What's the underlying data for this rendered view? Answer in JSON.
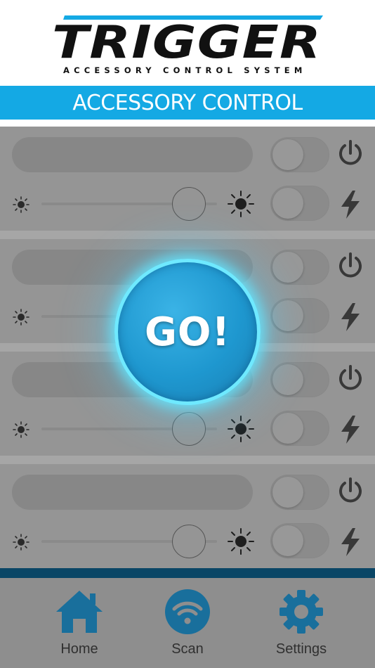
{
  "header": {
    "logo_text": "TRIGGER",
    "logo_subtitle": "ACCESSORY CONTROL SYSTEM"
  },
  "title_bar": {
    "title": "ACCESSORY CONTROL",
    "color": "#14a9e4"
  },
  "accessories": [
    {
      "name": "",
      "power_on": false,
      "flash_on": false,
      "brightness": 0.84
    },
    {
      "name": "",
      "power_on": false,
      "flash_on": false,
      "brightness": 0.84
    },
    {
      "name": "",
      "power_on": false,
      "flash_on": false,
      "brightness": 0.84
    },
    {
      "name": "",
      "power_on": false,
      "flash_on": false,
      "brightness": 0.84
    }
  ],
  "go_button": {
    "label": "GO!",
    "glow_color": "#6fe9ff"
  },
  "tabs": [
    {
      "label": "Home",
      "icon": "home-icon"
    },
    {
      "label": "Scan",
      "icon": "wifi-icon"
    },
    {
      "label": "Settings",
      "icon": "gear-icon"
    }
  ]
}
